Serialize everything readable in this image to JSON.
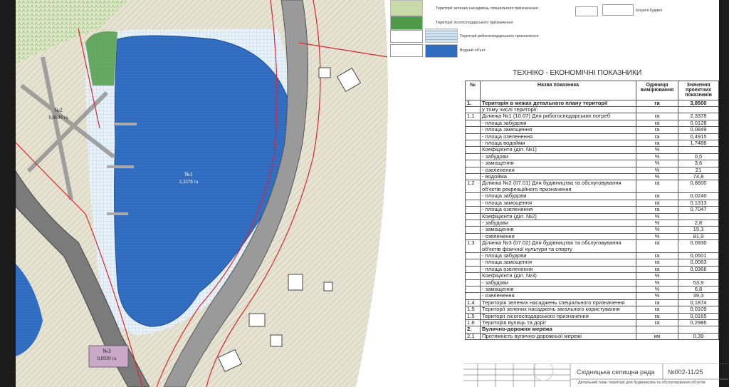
{
  "legend": {
    "items": [
      {
        "label": "Території зелених насаджень спеціального призначення",
        "color": "#c8dba8"
      },
      {
        "label": "Території лісогосподарського призначення",
        "color": "#4f9a48"
      },
      {
        "label": "Території рибогосподарського призначення",
        "color": "#cfe3f2"
      },
      {
        "label": "Водний об'єкт",
        "color": "#2f6cc0"
      }
    ],
    "existing_buildings_label": "Існуючі будівлі"
  },
  "map": {
    "plots": [
      {
        "label": "№1",
        "area": "2,3378 га"
      },
      {
        "label": "№2",
        "area": "0,8600 га"
      },
      {
        "label": "№3",
        "area": "0,0930 га"
      }
    ],
    "colors": {
      "water": "#2f6cc0",
      "forest": "#4f9a48",
      "recreation": "#b9d7ee",
      "road": "#6b6b6b",
      "redline": "#e0242b",
      "terrain": "#ece8da"
    }
  },
  "tei": {
    "title": "ТЕХНІКО - ЕКОНОМІЧНІ ПОКАЗНИКИ",
    "headers": {
      "num": "№",
      "name": "Назва показника",
      "unit": "Одиниця вимірювання",
      "value": "Значення проектних показників"
    },
    "rows": [
      {
        "num": "1.",
        "name": "Територія в межах детального плану території",
        "unit": "га",
        "value": "3,8500",
        "bold": true
      },
      {
        "num": "",
        "name": "у тому числі території:",
        "unit": "",
        "value": ""
      },
      {
        "num": "1.1",
        "name": "Ділянка №1 (10.07) Для рибогосподарських потреб",
        "unit": "га",
        "value": "2,3378"
      },
      {
        "num": "",
        "name": "- площа забудови",
        "unit": "га",
        "value": "0,0128"
      },
      {
        "num": "",
        "name": "- площа замощення",
        "unit": "га",
        "value": "0,0849"
      },
      {
        "num": "",
        "name": "- площа озеленення",
        "unit": "га",
        "value": "0,4915"
      },
      {
        "num": "",
        "name": "- площа водойми",
        "unit": "га",
        "value": "1,7486"
      },
      {
        "num": "",
        "name": "Коефіцієнти (діл. №1)",
        "unit": "%",
        "value": ""
      },
      {
        "num": "",
        "name": "- забудови",
        "unit": "%",
        "value": "0,5"
      },
      {
        "num": "",
        "name": "- замощення",
        "unit": "%",
        "value": "3,6"
      },
      {
        "num": "",
        "name": "- озеленення",
        "unit": "%",
        "value": "21"
      },
      {
        "num": "",
        "name": "- водойма",
        "unit": "%",
        "value": "74,8"
      },
      {
        "num": "1.2",
        "name": "Ділянка №2 (07.01) Для будівництва та обслуговування об'єктів рекреаційного призначення",
        "unit": "га",
        "value": "0,8600"
      },
      {
        "num": "",
        "name": "- площа забудови",
        "unit": "га",
        "value": "0,0240"
      },
      {
        "num": "",
        "name": "- площа замощення",
        "unit": "га",
        "value": "0,1313"
      },
      {
        "num": "",
        "name": "- площа озеленення",
        "unit": "га",
        "value": "0,7047"
      },
      {
        "num": "",
        "name": "Коефіцієнти (діл. №2)",
        "unit": "%",
        "value": ""
      },
      {
        "num": "",
        "name": "- забудови",
        "unit": "%",
        "value": "2,8"
      },
      {
        "num": "",
        "name": "- замощення",
        "unit": "%",
        "value": "15,3"
      },
      {
        "num": "",
        "name": "- озеленення",
        "unit": "%",
        "value": "81,9"
      },
      {
        "num": "1.3",
        "name": "Ділянка №3 (07.02) Для будівництва та обслуговування об'єктів фізичної культури та спорту",
        "unit": "га",
        "value": "0,0930"
      },
      {
        "num": "",
        "name": "- площа забудови",
        "unit": "га",
        "value": "0,0501"
      },
      {
        "num": "",
        "name": "- площа замощення",
        "unit": "га",
        "value": "0,0063"
      },
      {
        "num": "",
        "name": "- площа озеленення",
        "unit": "га",
        "value": "0,0366"
      },
      {
        "num": "",
        "name": "Коефіцієнти (діл. №3)",
        "unit": "%",
        "value": ""
      },
      {
        "num": "",
        "name": "- забудови",
        "unit": "%",
        "value": "53,9"
      },
      {
        "num": "",
        "name": "- замощення",
        "unit": "%",
        "value": "6,8"
      },
      {
        "num": "",
        "name": "- озеленення",
        "unit": "%",
        "value": "39,3"
      },
      {
        "num": "1.4",
        "name": "Територія зелених насаджень спеціального призначення",
        "unit": "га",
        "value": "0,1874"
      },
      {
        "num": "1.5",
        "name": "Території зелених насаджень загального користування",
        "unit": "га",
        "value": "0,0109"
      },
      {
        "num": "1.5",
        "name": "Території лісогосподарського призначення",
        "unit": "га",
        "value": "0,0165"
      },
      {
        "num": "1.6",
        "name": "Територія вулиць та доріг",
        "unit": "га",
        "value": "0,2986"
      },
      {
        "num": "2.",
        "name": "Вулично-дорожня мережа",
        "unit": "",
        "value": "",
        "bold": true
      },
      {
        "num": "2.1",
        "name": "Протяжність вулично-дорожньої мережі",
        "unit": "км",
        "value": "0,39"
      }
    ]
  },
  "stamp": {
    "org": "Східницька селищна рада",
    "number": "№002-11/25",
    "description": "Детальний план території для будівництва та обслуговування об'єктів"
  }
}
